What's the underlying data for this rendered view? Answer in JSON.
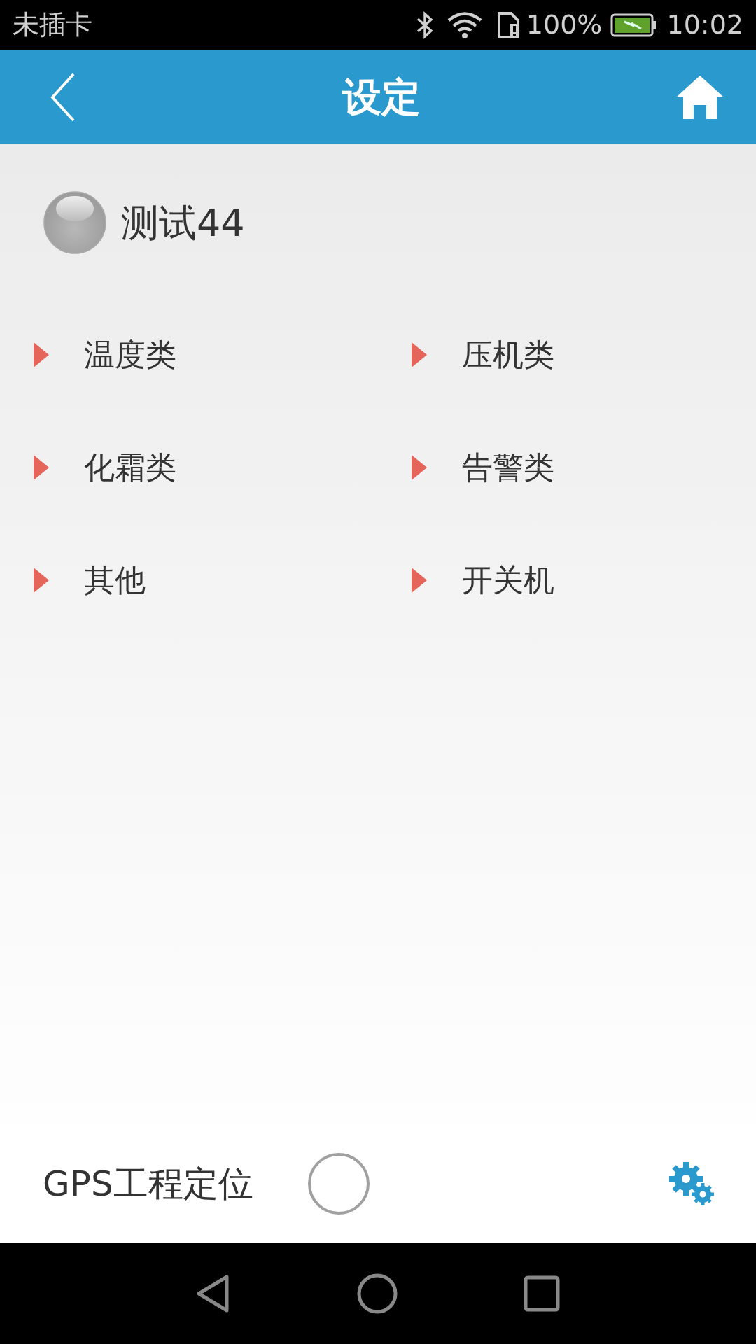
{
  "status_bar": {
    "carrier": "未插卡",
    "battery": "100%",
    "time": "10:02"
  },
  "header": {
    "title": "设定"
  },
  "device": {
    "name": "测试44"
  },
  "menu": [
    {
      "label": "温度类"
    },
    {
      "label": "压机类"
    },
    {
      "label": "化霜类"
    },
    {
      "label": "告警类"
    },
    {
      "label": "其他"
    },
    {
      "label": "开关机"
    }
  ],
  "gps": {
    "label": "GPS工程定位",
    "checked": false
  }
}
